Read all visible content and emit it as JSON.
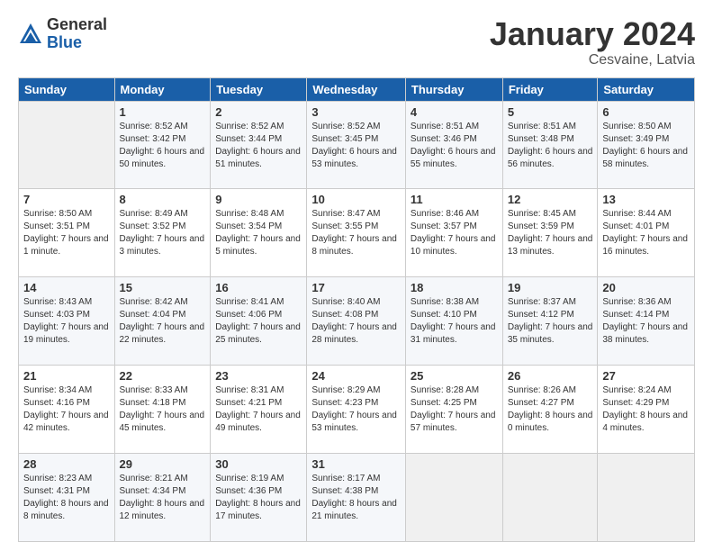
{
  "header": {
    "logo_general": "General",
    "logo_blue": "Blue",
    "month_title": "January 2024",
    "location": "Cesvaine, Latvia"
  },
  "days_of_week": [
    "Sunday",
    "Monday",
    "Tuesday",
    "Wednesday",
    "Thursday",
    "Friday",
    "Saturday"
  ],
  "weeks": [
    [
      {
        "day": "",
        "sunrise": "",
        "sunset": "",
        "daylight": "",
        "empty": true
      },
      {
        "day": "1",
        "sunrise": "Sunrise: 8:52 AM",
        "sunset": "Sunset: 3:42 PM",
        "daylight": "Daylight: 6 hours and 50 minutes."
      },
      {
        "day": "2",
        "sunrise": "Sunrise: 8:52 AM",
        "sunset": "Sunset: 3:44 PM",
        "daylight": "Daylight: 6 hours and 51 minutes."
      },
      {
        "day": "3",
        "sunrise": "Sunrise: 8:52 AM",
        "sunset": "Sunset: 3:45 PM",
        "daylight": "Daylight: 6 hours and 53 minutes."
      },
      {
        "day": "4",
        "sunrise": "Sunrise: 8:51 AM",
        "sunset": "Sunset: 3:46 PM",
        "daylight": "Daylight: 6 hours and 55 minutes."
      },
      {
        "day": "5",
        "sunrise": "Sunrise: 8:51 AM",
        "sunset": "Sunset: 3:48 PM",
        "daylight": "Daylight: 6 hours and 56 minutes."
      },
      {
        "day": "6",
        "sunrise": "Sunrise: 8:50 AM",
        "sunset": "Sunset: 3:49 PM",
        "daylight": "Daylight: 6 hours and 58 minutes."
      }
    ],
    [
      {
        "day": "7",
        "sunrise": "Sunrise: 8:50 AM",
        "sunset": "Sunset: 3:51 PM",
        "daylight": "Daylight: 7 hours and 1 minute."
      },
      {
        "day": "8",
        "sunrise": "Sunrise: 8:49 AM",
        "sunset": "Sunset: 3:52 PM",
        "daylight": "Daylight: 7 hours and 3 minutes."
      },
      {
        "day": "9",
        "sunrise": "Sunrise: 8:48 AM",
        "sunset": "Sunset: 3:54 PM",
        "daylight": "Daylight: 7 hours and 5 minutes."
      },
      {
        "day": "10",
        "sunrise": "Sunrise: 8:47 AM",
        "sunset": "Sunset: 3:55 PM",
        "daylight": "Daylight: 7 hours and 8 minutes."
      },
      {
        "day": "11",
        "sunrise": "Sunrise: 8:46 AM",
        "sunset": "Sunset: 3:57 PM",
        "daylight": "Daylight: 7 hours and 10 minutes."
      },
      {
        "day": "12",
        "sunrise": "Sunrise: 8:45 AM",
        "sunset": "Sunset: 3:59 PM",
        "daylight": "Daylight: 7 hours and 13 minutes."
      },
      {
        "day": "13",
        "sunrise": "Sunrise: 8:44 AM",
        "sunset": "Sunset: 4:01 PM",
        "daylight": "Daylight: 7 hours and 16 minutes."
      }
    ],
    [
      {
        "day": "14",
        "sunrise": "Sunrise: 8:43 AM",
        "sunset": "Sunset: 4:03 PM",
        "daylight": "Daylight: 7 hours and 19 minutes."
      },
      {
        "day": "15",
        "sunrise": "Sunrise: 8:42 AM",
        "sunset": "Sunset: 4:04 PM",
        "daylight": "Daylight: 7 hours and 22 minutes."
      },
      {
        "day": "16",
        "sunrise": "Sunrise: 8:41 AM",
        "sunset": "Sunset: 4:06 PM",
        "daylight": "Daylight: 7 hours and 25 minutes."
      },
      {
        "day": "17",
        "sunrise": "Sunrise: 8:40 AM",
        "sunset": "Sunset: 4:08 PM",
        "daylight": "Daylight: 7 hours and 28 minutes."
      },
      {
        "day": "18",
        "sunrise": "Sunrise: 8:38 AM",
        "sunset": "Sunset: 4:10 PM",
        "daylight": "Daylight: 7 hours and 31 minutes."
      },
      {
        "day": "19",
        "sunrise": "Sunrise: 8:37 AM",
        "sunset": "Sunset: 4:12 PM",
        "daylight": "Daylight: 7 hours and 35 minutes."
      },
      {
        "day": "20",
        "sunrise": "Sunrise: 8:36 AM",
        "sunset": "Sunset: 4:14 PM",
        "daylight": "Daylight: 7 hours and 38 minutes."
      }
    ],
    [
      {
        "day": "21",
        "sunrise": "Sunrise: 8:34 AM",
        "sunset": "Sunset: 4:16 PM",
        "daylight": "Daylight: 7 hours and 42 minutes."
      },
      {
        "day": "22",
        "sunrise": "Sunrise: 8:33 AM",
        "sunset": "Sunset: 4:18 PM",
        "daylight": "Daylight: 7 hours and 45 minutes."
      },
      {
        "day": "23",
        "sunrise": "Sunrise: 8:31 AM",
        "sunset": "Sunset: 4:21 PM",
        "daylight": "Daylight: 7 hours and 49 minutes."
      },
      {
        "day": "24",
        "sunrise": "Sunrise: 8:29 AM",
        "sunset": "Sunset: 4:23 PM",
        "daylight": "Daylight: 7 hours and 53 minutes."
      },
      {
        "day": "25",
        "sunrise": "Sunrise: 8:28 AM",
        "sunset": "Sunset: 4:25 PM",
        "daylight": "Daylight: 7 hours and 57 minutes."
      },
      {
        "day": "26",
        "sunrise": "Sunrise: 8:26 AM",
        "sunset": "Sunset: 4:27 PM",
        "daylight": "Daylight: 8 hours and 0 minutes."
      },
      {
        "day": "27",
        "sunrise": "Sunrise: 8:24 AM",
        "sunset": "Sunset: 4:29 PM",
        "daylight": "Daylight: 8 hours and 4 minutes."
      }
    ],
    [
      {
        "day": "28",
        "sunrise": "Sunrise: 8:23 AM",
        "sunset": "Sunset: 4:31 PM",
        "daylight": "Daylight: 8 hours and 8 minutes."
      },
      {
        "day": "29",
        "sunrise": "Sunrise: 8:21 AM",
        "sunset": "Sunset: 4:34 PM",
        "daylight": "Daylight: 8 hours and 12 minutes."
      },
      {
        "day": "30",
        "sunrise": "Sunrise: 8:19 AM",
        "sunset": "Sunset: 4:36 PM",
        "daylight": "Daylight: 8 hours and 17 minutes."
      },
      {
        "day": "31",
        "sunrise": "Sunrise: 8:17 AM",
        "sunset": "Sunset: 4:38 PM",
        "daylight": "Daylight: 8 hours and 21 minutes."
      },
      {
        "day": "",
        "sunrise": "",
        "sunset": "",
        "daylight": "",
        "empty": true
      },
      {
        "day": "",
        "sunrise": "",
        "sunset": "",
        "daylight": "",
        "empty": true
      },
      {
        "day": "",
        "sunrise": "",
        "sunset": "",
        "daylight": "",
        "empty": true
      }
    ]
  ]
}
